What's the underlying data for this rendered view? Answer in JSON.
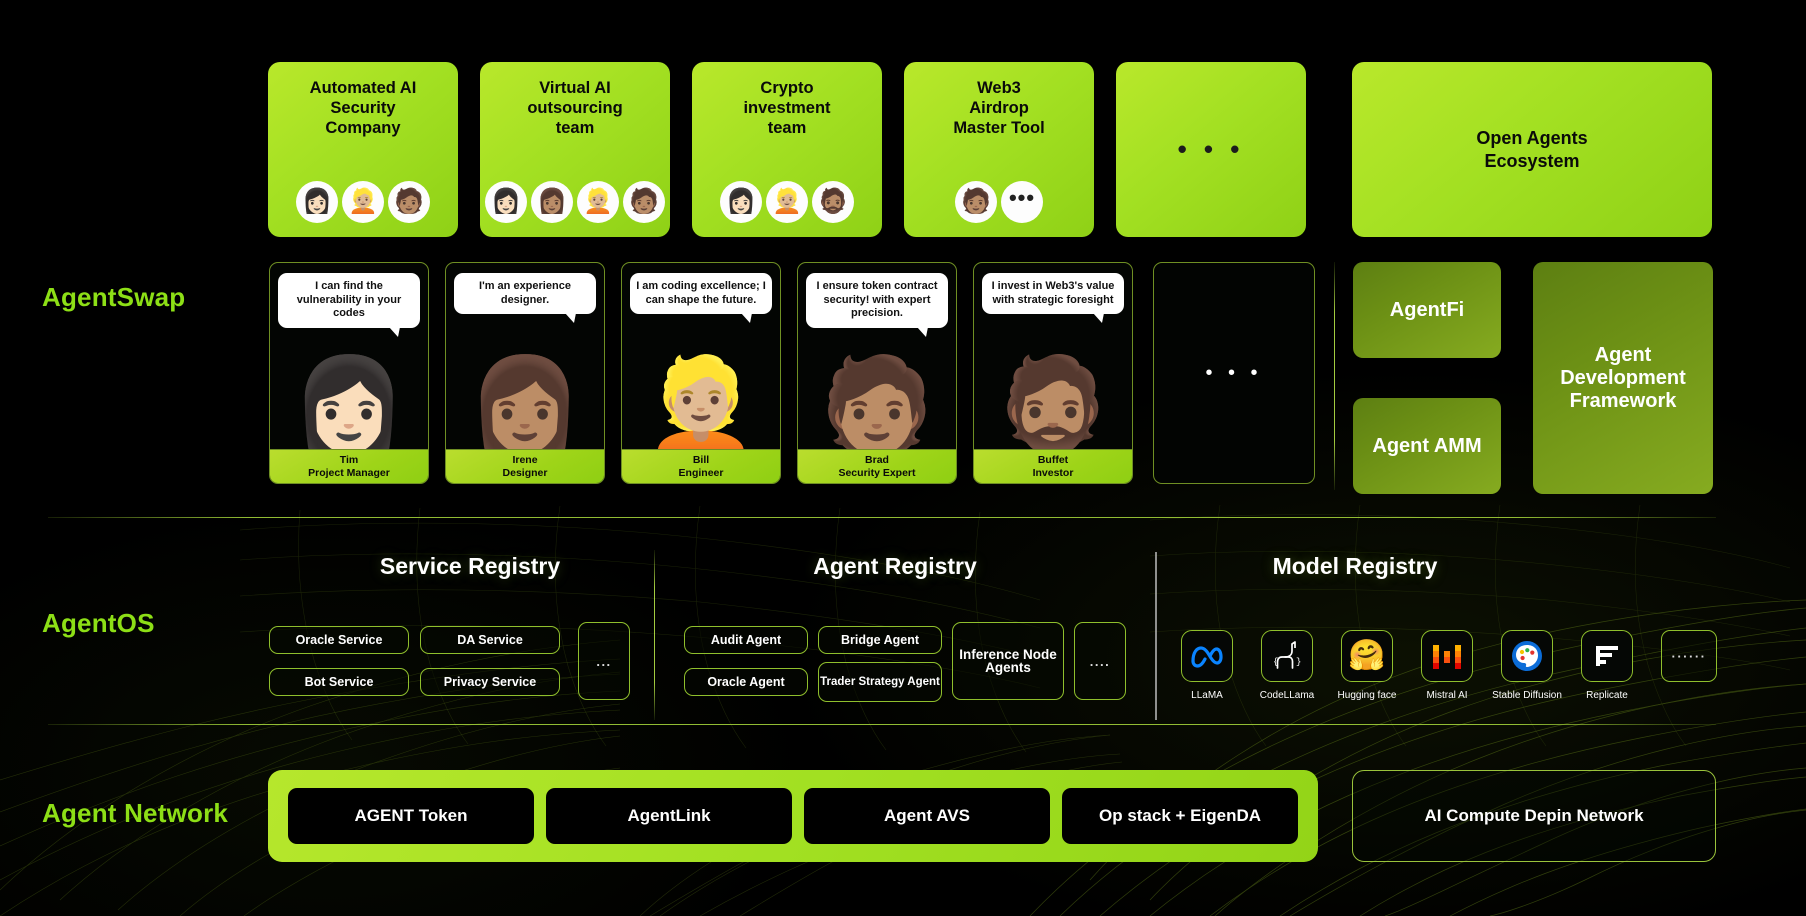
{
  "rows": {
    "agentswap_label": "AgentSwap",
    "agentos_label": "AgentOS",
    "network_label": "Agent Network"
  },
  "colors": {
    "brand_green": "#8ddf16",
    "card_green": "#a3e022",
    "olive": "#6d9115",
    "background": "#000000",
    "pill_border": "#8fbf2c"
  },
  "products": [
    {
      "title": "Automated AI\nSecurity\nCompany",
      "avatars": [
        "woman-avatar",
        "man-avatar",
        "man-cap-avatar"
      ],
      "ellipsis": false
    },
    {
      "title": "Virtual AI\noutsourcing\nteam",
      "avatars": [
        "woman-avatar",
        "woman-bun-avatar",
        "man-blond-avatar",
        "man-cap-avatar"
      ],
      "ellipsis": false
    },
    {
      "title": "Crypto\ninvestment\nteam",
      "avatars": [
        "woman-avatar",
        "man-blond-avatar",
        "man-beard-avatar"
      ],
      "ellipsis": false
    },
    {
      "title": "Web3\nAirdrop\nMaster Tool",
      "avatars": [
        "man-cap-avatar",
        "more-dots"
      ],
      "ellipsis": false
    },
    {
      "title": "",
      "avatars": [],
      "ellipsis": true,
      "ellipsis_text": "• • •"
    },
    {
      "title": "Open Agents\nEcosystem",
      "avatars": [],
      "ellipsis": false
    }
  ],
  "agents": [
    {
      "quote": "I can find the vulnerability in your codes",
      "name": "Tim",
      "role": "Project Manager",
      "face": "woman-glasses-avatar"
    },
    {
      "quote": "I'm an experience designer.",
      "name": "Irene",
      "role": "Designer",
      "face": "woman-bun-avatar"
    },
    {
      "quote": "I am coding excellence; I can shape the future.",
      "name": "Bill",
      "role": "Engineer",
      "face": "man-blond-avatar"
    },
    {
      "quote": "I ensure token contract security! with expert precision.",
      "name": "Brad",
      "role": "Security Expert",
      "face": "man-cap-avatar"
    },
    {
      "quote": "I invest in Web3's value with strategic foresight",
      "name": "Buffet",
      "role": "Investor",
      "face": "man-beard-avatar"
    }
  ],
  "agents_more_placeholder": "• • •",
  "side_panels": {
    "agentfi": "AgentFi",
    "agent_amm": "Agent AMM",
    "agent_dev_framework": "Agent\nDevelopment\nFramework"
  },
  "service_registry": {
    "title": "Service Registry",
    "pills": [
      "Oracle Service",
      "DA Service",
      "Bot Service",
      "Privacy Service"
    ],
    "more": "..."
  },
  "agent_registry": {
    "title": "Agent Registry",
    "pills": [
      "Audit Agent",
      "Bridge Agent",
      "Oracle Agent",
      "Trader Strategy Agent"
    ],
    "inference": "Inference Node Agents",
    "more": "...."
  },
  "model_registry": {
    "title": "Model Registry",
    "models": [
      {
        "name": "LLaMA",
        "icon": "meta-logo-icon"
      },
      {
        "name": "CodeLLama",
        "icon": "llama-logo-icon"
      },
      {
        "name": "Hugging face",
        "icon": "hugging-face-logo-icon"
      },
      {
        "name": "Mistral AI",
        "icon": "mistral-logo-icon"
      },
      {
        "name": "Stable Diffusion",
        "icon": "stable-diffusion-logo-icon"
      },
      {
        "name": "Replicate",
        "icon": "replicate-logo-icon"
      }
    ],
    "more": "······"
  },
  "agent_network": {
    "chips": [
      "AGENT Token",
      "AgentLink",
      "Agent AVS",
      "Op stack + EigenDA"
    ],
    "depin": "AI Compute Depin Network"
  }
}
